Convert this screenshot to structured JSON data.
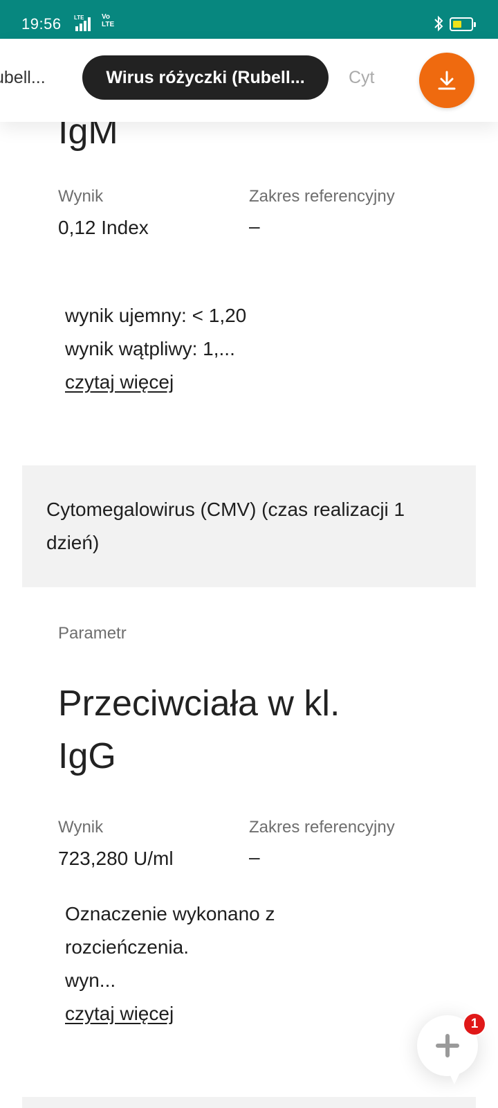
{
  "status_bar": {
    "time": "19:56",
    "network_1": "LTE",
    "network_2_top": "Vo",
    "network_2_bottom": "LTE",
    "bluetooth_icon": "bluetooth-icon",
    "battery_icon": "battery-icon"
  },
  "tabs": {
    "left": "ubell...",
    "active": "Wirus różyczki (Rubell...",
    "right": "Cyt"
  },
  "download_button_icon": "download-icon",
  "prev_result": {
    "title_fragment": "IgM",
    "result_label": "Wynik",
    "result_value": "0,12 Index",
    "ref_label": "Zakres referencyjny",
    "ref_value": "–",
    "note_line1": "wynik ujemny: < 1,20",
    "note_line2": "wynik wątpliwy: 1,...",
    "read_more": "czytaj więcej"
  },
  "section": {
    "title": "Cytomegalowirus (CMV) (czas realizacji 1 dzień)"
  },
  "cmv_result": {
    "param_label": "Parametr",
    "title_line1": "Przeciwciała w kl.",
    "title_line2": "IgG",
    "result_label": "Wynik",
    "result_value": "723,280 U/ml",
    "ref_label": "Zakres referencyjny",
    "ref_value": "–",
    "note_line1": "Oznaczenie wykonano z",
    "note_line2": "rozcieńczenia.",
    "note_line3": "wyn...",
    "read_more": "czytaj więcej"
  },
  "fab": {
    "icon": "plus-icon",
    "badge_count": "1"
  },
  "colors": {
    "status_bar": "#07877f",
    "active_tab": "#222222",
    "download_button": "#ef6a0f",
    "section_bg": "#f2f2f2",
    "badge": "#e01818"
  }
}
